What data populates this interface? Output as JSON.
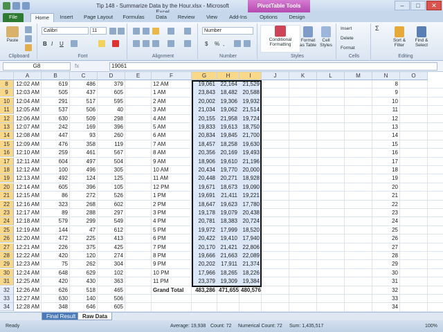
{
  "window": {
    "title": "Tip 148 - Summarize Data by the Hour.xlsx - Microsoft Excel",
    "context_tab": "PivotTable Tools",
    "minimize": "–",
    "maximize": "□",
    "close": "✕"
  },
  "tabs": [
    "File",
    "Home",
    "Insert",
    "Page Layout",
    "Formulas",
    "Data",
    "Review",
    "View",
    "Add-Ins",
    "Options",
    "Design"
  ],
  "ribbon": {
    "paste": "Paste",
    "font_name": "Calibri",
    "font_size": "11",
    "number_format": "Number",
    "groups": {
      "clipboard": "Clipboard",
      "font": "Font",
      "alignment": "Alignment",
      "number": "Number",
      "styles": "Styles",
      "cells": "Cells",
      "editing": "Editing"
    },
    "cond_fmt": "Conditional Formatting",
    "format_table": "Format as Table",
    "cell_styles": "Cell Styles",
    "insert": "Insert",
    "delete": "Delete",
    "format": "Format",
    "sort_filter": "Sort & Filter",
    "find_select": "Find & Select",
    "bold": "B",
    "italic": "I",
    "underline": "U",
    "currency": "$",
    "percent": "%",
    "comma": ","
  },
  "formula_bar": {
    "name_box": "G8",
    "fx": "fx",
    "value": "19061"
  },
  "columns": [
    "A",
    "B",
    "C",
    "D",
    "E",
    "F",
    "G",
    "H",
    "I",
    "J",
    "K",
    "L",
    "M",
    "N",
    "O"
  ],
  "rows": [
    {
      "n": "8",
      "a": "12:02 AM",
      "b": "619",
      "c": "486",
      "d": "379",
      "f": "12 AM",
      "g": "19,061",
      "h": "22,164",
      "i": "21,529"
    },
    {
      "n": "9",
      "a": "12:03 AM",
      "b": "505",
      "c": "437",
      "d": "605",
      "f": "1 AM",
      "g": "23,843",
      "h": "18,482",
      "i": "20,588"
    },
    {
      "n": "10",
      "a": "12:04 AM",
      "b": "291",
      "c": "517",
      "d": "595",
      "f": "2 AM",
      "g": "20,002",
      "h": "19,306",
      "i": "19,932"
    },
    {
      "n": "11",
      "a": "12:05 AM",
      "b": "537",
      "c": "506",
      "d": "40",
      "f": "3 AM",
      "g": "21,034",
      "h": "19,062",
      "i": "21,514"
    },
    {
      "n": "12",
      "a": "12:06 AM",
      "b": "630",
      "c": "509",
      "d": "298",
      "f": "4 AM",
      "g": "20,155",
      "h": "21,958",
      "i": "19,724"
    },
    {
      "n": "13",
      "a": "12:07 AM",
      "b": "242",
      "c": "169",
      "d": "396",
      "f": "5 AM",
      "g": "19,833",
      "h": "19,613",
      "i": "18,750"
    },
    {
      "n": "14",
      "a": "12:08 AM",
      "b": "447",
      "c": "93",
      "d": "260",
      "f": "6 AM",
      "g": "20,834",
      "h": "19,845",
      "i": "21,700"
    },
    {
      "n": "15",
      "a": "12:09 AM",
      "b": "476",
      "c": "358",
      "d": "119",
      "f": "7 AM",
      "g": "18,457",
      "h": "18,258",
      "i": "19,630"
    },
    {
      "n": "16",
      "a": "12:10 AM",
      "b": "259",
      "c": "461",
      "d": "567",
      "f": "8 AM",
      "g": "20,356",
      "h": "20,169",
      "i": "19,493"
    },
    {
      "n": "17",
      "a": "12:11 AM",
      "b": "604",
      "c": "497",
      "d": "504",
      "f": "9 AM",
      "g": "18,906",
      "h": "19,610",
      "i": "21,196"
    },
    {
      "n": "18",
      "a": "12:12 AM",
      "b": "100",
      "c": "496",
      "d": "305",
      "f": "10 AM",
      "g": "20,434",
      "h": "19,770",
      "i": "20,000"
    },
    {
      "n": "19",
      "a": "12:13 AM",
      "b": "492",
      "c": "124",
      "d": "125",
      "f": "11 AM",
      "g": "20,448",
      "h": "20,271",
      "i": "18,928"
    },
    {
      "n": "20",
      "a": "12:14 AM",
      "b": "605",
      "c": "396",
      "d": "105",
      "f": "12 PM",
      "g": "19,671",
      "h": "18,673",
      "i": "19,090"
    },
    {
      "n": "21",
      "a": "12:15 AM",
      "b": "86",
      "c": "272",
      "d": "526",
      "f": "1 PM",
      "g": "19,691",
      "h": "21,411",
      "i": "19,221"
    },
    {
      "n": "22",
      "a": "12:16 AM",
      "b": "323",
      "c": "268",
      "d": "602",
      "f": "2 PM",
      "g": "18,647",
      "h": "19,623",
      "i": "17,780"
    },
    {
      "n": "23",
      "a": "12:17 AM",
      "b": "89",
      "c": "288",
      "d": "297",
      "f": "3 PM",
      "g": "19,178",
      "h": "19,079",
      "i": "20,438"
    },
    {
      "n": "24",
      "a": "12:18 AM",
      "b": "579",
      "c": "299",
      "d": "549",
      "f": "4 PM",
      "g": "20,781",
      "h": "18,383",
      "i": "20,724"
    },
    {
      "n": "25",
      "a": "12:19 AM",
      "b": "144",
      "c": "47",
      "d": "612",
      "f": "5 PM",
      "g": "19,972",
      "h": "17,999",
      "i": "18,520"
    },
    {
      "n": "26",
      "a": "12:20 AM",
      "b": "472",
      "c": "225",
      "d": "413",
      "f": "6 PM",
      "g": "20,422",
      "h": "19,410",
      "i": "17,940"
    },
    {
      "n": "27",
      "a": "12:21 AM",
      "b": "226",
      "c": "375",
      "d": "425",
      "f": "7 PM",
      "g": "20,170",
      "h": "21,421",
      "i": "22,806"
    },
    {
      "n": "28",
      "a": "12:22 AM",
      "b": "420",
      "c": "120",
      "d": "274",
      "f": "8 PM",
      "g": "19,666",
      "h": "21,663",
      "i": "22,089"
    },
    {
      "n": "29",
      "a": "12:23 AM",
      "b": "75",
      "c": "262",
      "d": "304",
      "f": "9 PM",
      "g": "20,202",
      "h": "17,911",
      "i": "21,374"
    },
    {
      "n": "30",
      "a": "12:24 AM",
      "b": "648",
      "c": "629",
      "d": "102",
      "f": "10 PM",
      "g": "17,966",
      "h": "18,265",
      "i": "18,226"
    },
    {
      "n": "31",
      "a": "12:25 AM",
      "b": "420",
      "c": "430",
      "d": "363",
      "f": "11 PM",
      "g": "23,379",
      "h": "19,309",
      "i": "19,384"
    },
    {
      "n": "32",
      "a": "12:26 AM",
      "b": "626",
      "c": "518",
      "d": "465",
      "f": "Grand Total",
      "g": "483,286",
      "h": "471,655",
      "i": "480,576"
    },
    {
      "n": "33",
      "a": "12:27 AM",
      "b": "630",
      "c": "140",
      "d": "506",
      "f": "",
      "g": "",
      "h": "",
      "i": ""
    },
    {
      "n": "34",
      "a": "12:28 AM",
      "b": "348",
      "c": "646",
      "d": "605",
      "f": "",
      "g": "",
      "h": "",
      "i": ""
    }
  ],
  "sheets": [
    "Final Result",
    "Raw Data"
  ],
  "status": {
    "mode": "Ready",
    "average": "Average: 19,938",
    "count": "Count: 72",
    "numerical_count": "Numerical Count: 72",
    "sum": "Sum: 1,435,517",
    "zoom": "100%"
  },
  "colors": {
    "pivot_context": "#b44ab0",
    "file_tab": "#2f7a32",
    "selection": "#dce8f7",
    "header_selected": "#f9d889"
  }
}
